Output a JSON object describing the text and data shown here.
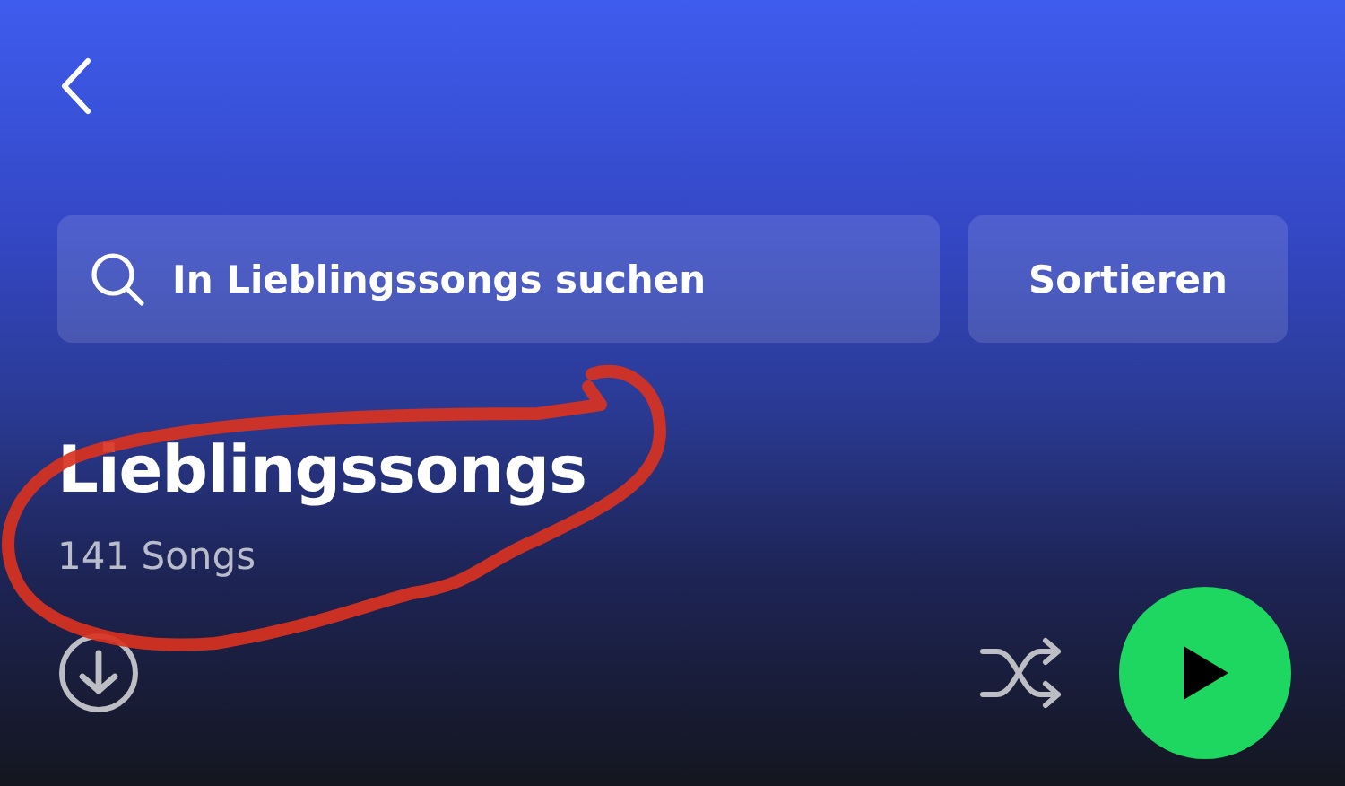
{
  "search": {
    "placeholder": "In Lieblingssongs suchen"
  },
  "sort_button": {
    "label": "Sortieren"
  },
  "playlist": {
    "title": "Lieblingssongs",
    "subtitle": "141 Songs"
  }
}
